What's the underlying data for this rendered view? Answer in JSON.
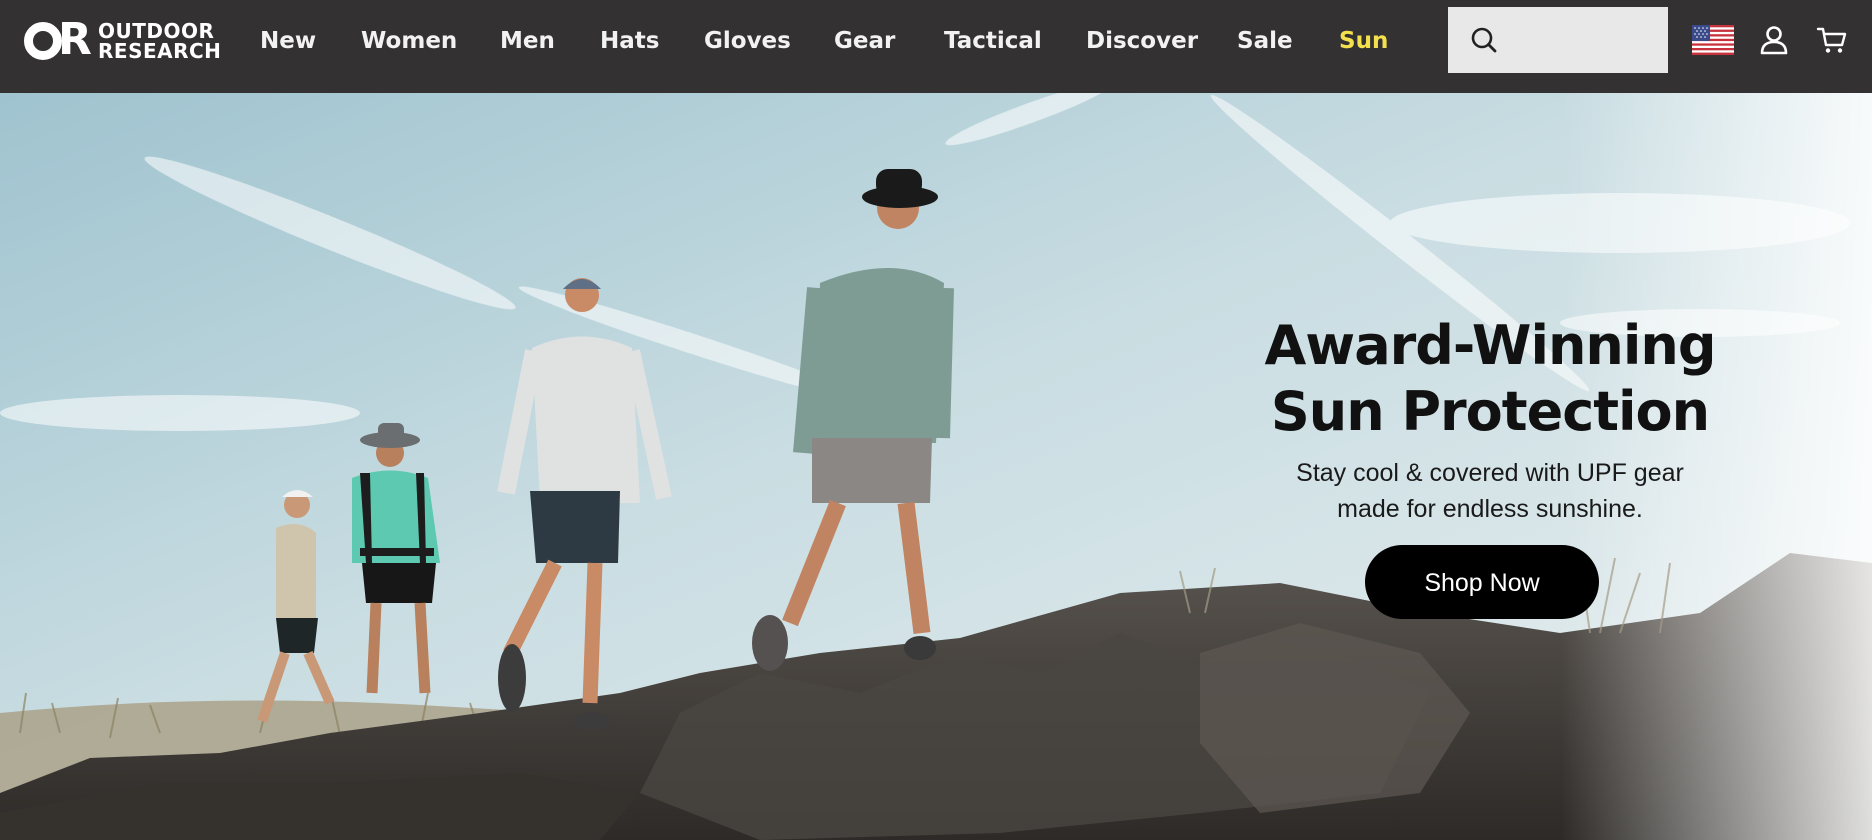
{
  "brand": {
    "line1": "OUTDOOR",
    "line2": "RESEARCH",
    "mark_letter": "R"
  },
  "nav": {
    "items": [
      {
        "label": "New"
      },
      {
        "label": "Women"
      },
      {
        "label": "Men"
      },
      {
        "label": "Hats"
      },
      {
        "label": "Gloves"
      },
      {
        "label": "Gear"
      },
      {
        "label": "Tactical"
      },
      {
        "label": "Discover"
      },
      {
        "label": "Sale"
      },
      {
        "label": "Sun",
        "highlight_color": "#f4e04d"
      }
    ]
  },
  "search": {
    "placeholder": "",
    "value": "",
    "icon": "search-icon"
  },
  "utility": {
    "flag_icon": "us-flag-icon",
    "account_icon": "user-icon",
    "cart_icon": "cart-icon"
  },
  "hero": {
    "title_line1": "Award-Winning",
    "title_line2": "Sun Protection",
    "subtitle_line1": "Stay cool & covered with UPF gear",
    "subtitle_line2": "made for endless sunshine.",
    "cta_label": "Shop Now"
  },
  "colors": {
    "topbar": "#333132",
    "nav_text": "#f2f2f2",
    "accent_sun": "#f4e04d",
    "cta_bg": "#000000",
    "cta_text": "#ffffff"
  }
}
